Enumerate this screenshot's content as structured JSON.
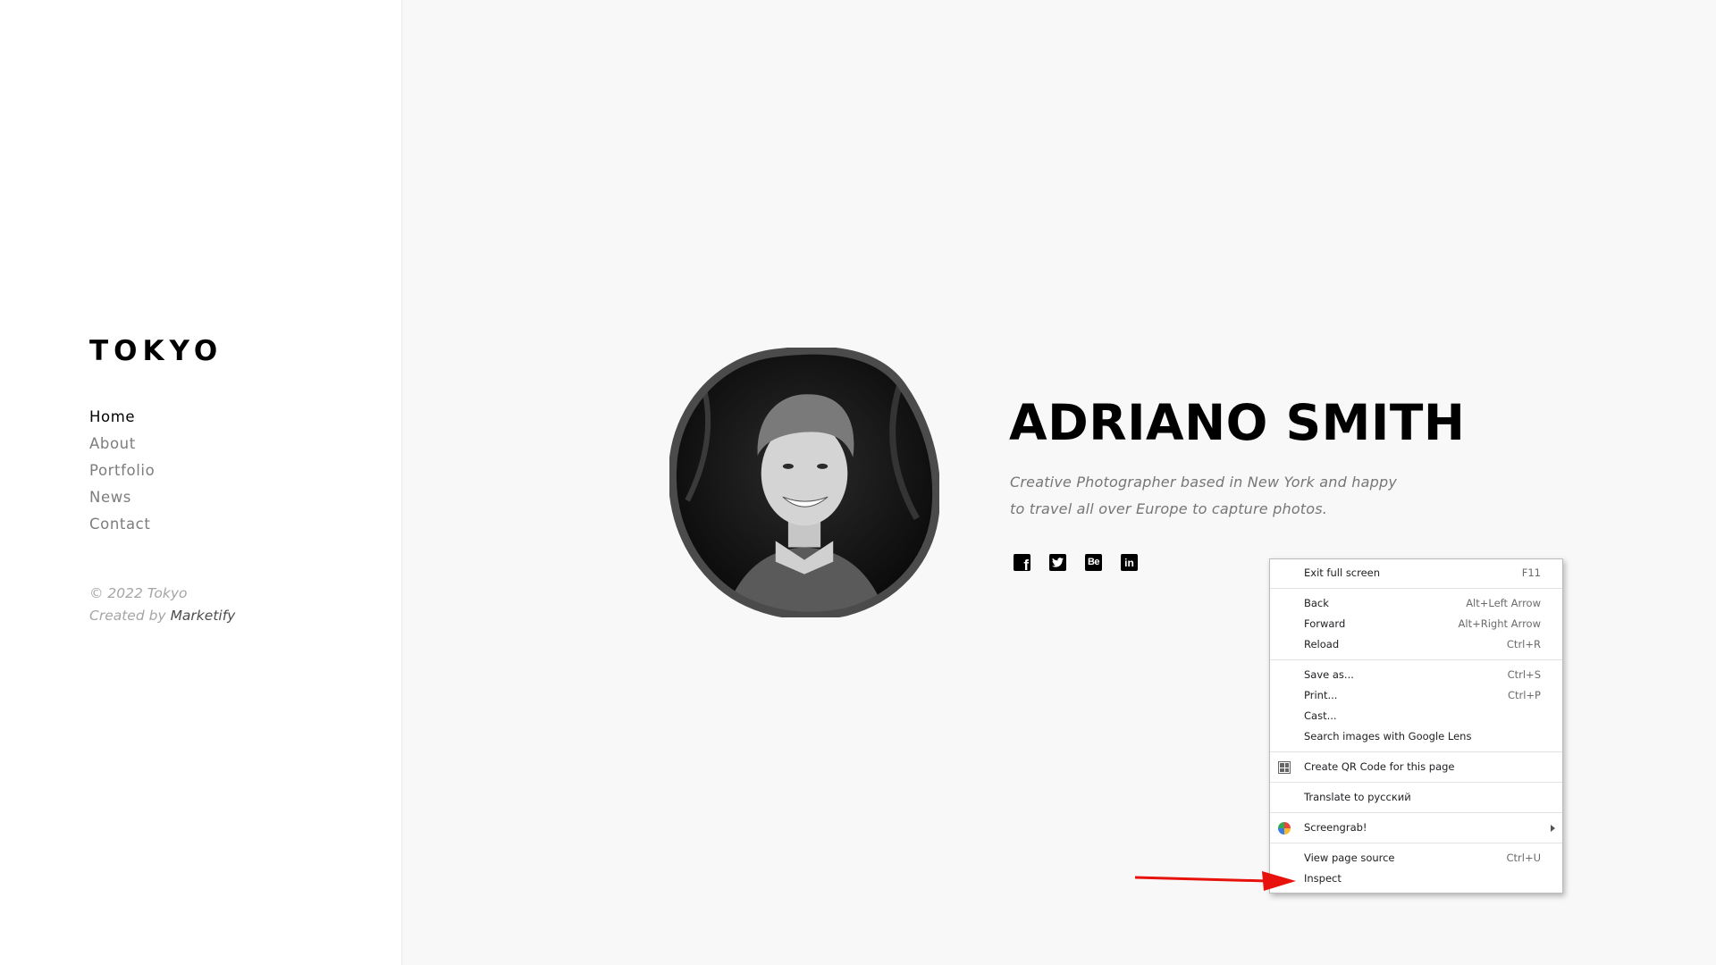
{
  "sidebar": {
    "logo": "TOKYO",
    "nav": [
      "Home",
      "About",
      "Portfolio",
      "News",
      "Contact"
    ],
    "active_nav": "Home",
    "copyright": "© 2022 Tokyo",
    "created_by_prefix": "Created by",
    "created_by_brand": "Marketify"
  },
  "hero": {
    "name": "ADRIANO SMITH",
    "description_line1": "Creative Photographer based in New York and happy",
    "description_line2": "to travel all over Europe to capture photos.",
    "social": [
      "facebook-icon",
      "twitter-icon",
      "behance-icon",
      "linkedin-icon"
    ]
  },
  "context_menu": {
    "exit_full_screen": "Exit full screen",
    "exit_full_screen_shortcut": "F11",
    "back": "Back",
    "back_shortcut": "Alt+Left Arrow",
    "forward": "Forward",
    "forward_shortcut": "Alt+Right Arrow",
    "reload": "Reload",
    "reload_shortcut": "Ctrl+R",
    "save_as": "Save as...",
    "save_as_shortcut": "Ctrl+S",
    "print": "Print...",
    "print_shortcut": "Ctrl+P",
    "cast": "Cast...",
    "search_lens": "Search images with Google Lens",
    "qr_code": "Create QR Code for this page",
    "translate": "Translate to русский",
    "screengrab": "Screengrab!",
    "view_source": "View page source",
    "view_source_shortcut": "Ctrl+U",
    "inspect": "Inspect"
  },
  "colors": {
    "annotation_arrow": "#e8120c",
    "background": "#f8f8f8",
    "sidebar": "#ffffff"
  }
}
